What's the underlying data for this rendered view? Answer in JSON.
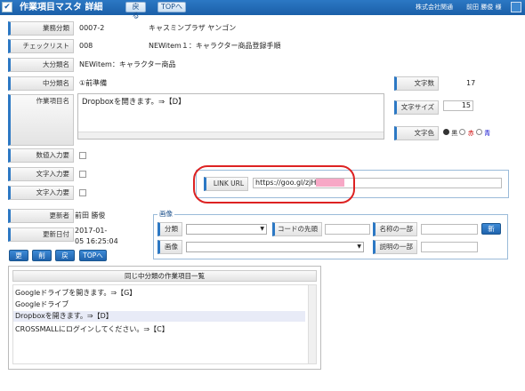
{
  "topbar": {
    "logo": "✔",
    "title": "作業項目マスタ 詳細",
    "back": "戻る",
    "top": "TOPへ",
    "company": "株式会社関通",
    "user": "前田 勝俊 様"
  },
  "form": {
    "gyomu_label": "業務分類",
    "gyomu_code": "0007-2",
    "gyomu_name": "キャスミンプラザ ヤンゴン",
    "check_label": "チェックリスト",
    "check_code": "008",
    "check_name": "NEWitem１：キャラクター商品登録手順",
    "dai_label": "大分類名",
    "dai_value": "NEWitem：キャラクター商品",
    "chu_label": "中分類名",
    "chu_value": "①前準備",
    "item_label": "作業項目名",
    "item_value": "Dropboxを開きます。⇒【D】",
    "charcount_label": "文字数",
    "charcount_value": "17",
    "fontsize_label": "文字サイズ",
    "fontsize_value": "15",
    "color_label": "文字色",
    "color_options": [
      "黒",
      "赤",
      "青"
    ],
    "num_label": "数値入力要",
    "text_label1": "文字入力要",
    "text_label2": "文字入力要",
    "link_label": "LINK URL",
    "link_value": "https://goo.gl/zjH",
    "updater_label": "更新者",
    "updater_value": "前田 勝俊",
    "updated_label": "更新日付",
    "updated_date": "2017-01-",
    "updated_time": "05 16:25:04"
  },
  "buttons": {
    "update": "更新",
    "delete": "削除",
    "back": "戻る",
    "top": "TOPへ"
  },
  "image_section": {
    "title": "画像",
    "bunrui_label": "分類",
    "code_label": "コードの先頭",
    "name_label": "名称の一部",
    "new_button": "新規",
    "image_label": "画像",
    "desc_label": "説明の一部"
  },
  "list": {
    "title": "同じ中分類の作業項目一覧",
    "items": [
      "Googleドライブを開きます。⇒【G】",
      "Googleドライブ",
      "Dropboxを開きます。⇒【D】",
      "CROSSMALLにログインしてください。⇒【C】"
    ]
  }
}
